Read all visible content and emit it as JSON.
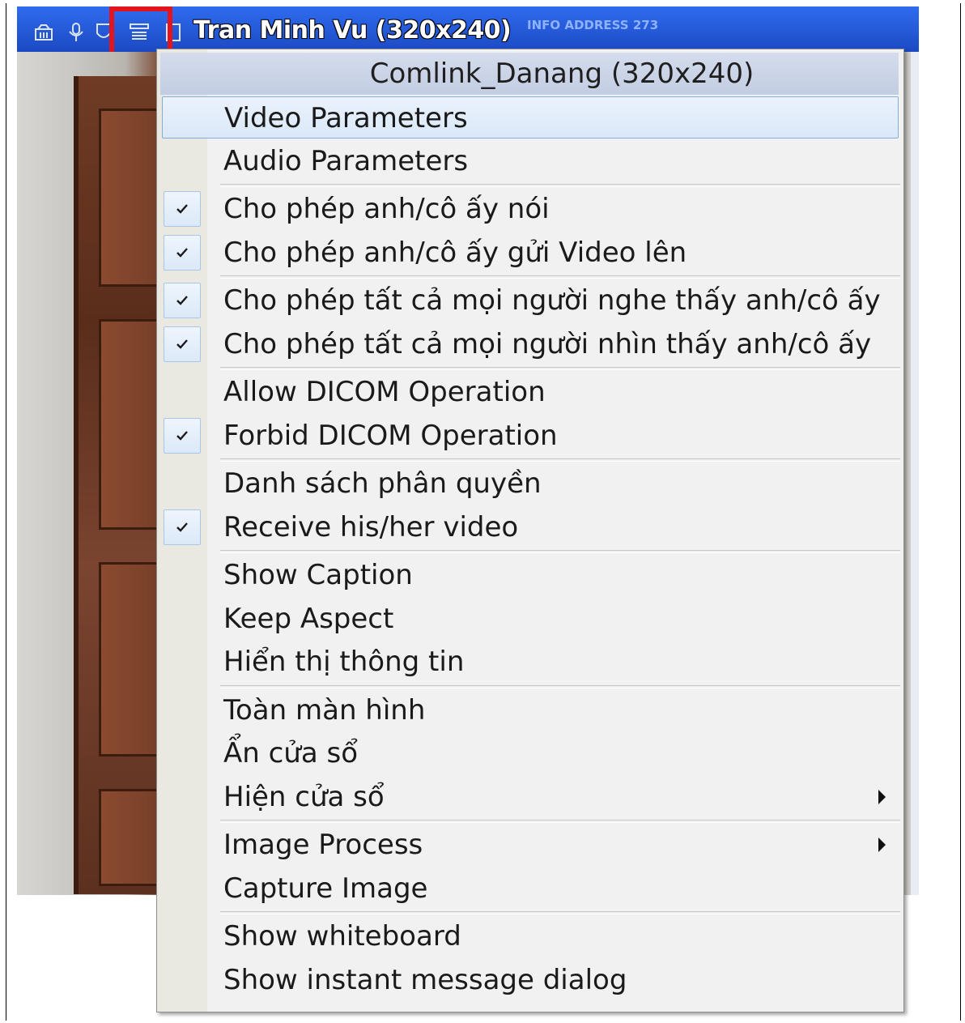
{
  "window": {
    "title": "Tran Minh Vu (320x240)",
    "title_faint": "INFO ADDRESS 273",
    "toolbar_icons": [
      "camera-icon",
      "microphone-icon",
      "shield-icon",
      "menu-list-icon",
      "window-icon"
    ],
    "highlight_color": "#e3141b"
  },
  "menu": {
    "header": "Comlink_Danang (320x240)",
    "groups": [
      [
        {
          "label": "Video Parameters",
          "checked": false,
          "selected": true
        },
        {
          "label": "Audio Parameters",
          "checked": false
        }
      ],
      [
        {
          "label": "Cho phép anh/cô ấy nói",
          "checked": true
        },
        {
          "label": "Cho phép anh/cô ấy gửi Video lên",
          "checked": true
        }
      ],
      [
        {
          "label": "Cho phép tất cả mọi người nghe thấy anh/cô ấy",
          "checked": true
        },
        {
          "label": "Cho phép tất cả mọi người nhìn thấy anh/cô ấy",
          "checked": true
        }
      ],
      [
        {
          "label": "Allow DICOM Operation",
          "checked": false
        },
        {
          "label": "Forbid DICOM Operation",
          "checked": true
        }
      ],
      [
        {
          "label": "Danh sách phân quyền",
          "checked": false
        },
        {
          "label": "Receive his/her video",
          "checked": true
        }
      ],
      [
        {
          "label": "Show Caption",
          "checked": false
        },
        {
          "label": "Keep Aspect",
          "checked": false
        },
        {
          "label": "Hiển thị thông tin",
          "checked": false
        }
      ],
      [
        {
          "label": "Toàn màn hình",
          "checked": false
        },
        {
          "label": "Ẩn cửa sổ",
          "checked": false
        },
        {
          "label": "Hiện cửa sổ",
          "checked": false,
          "submenu": true
        }
      ],
      [
        {
          "label": "Image Process",
          "checked": false,
          "submenu": true
        },
        {
          "label": "Capture Image",
          "checked": false
        }
      ],
      [
        {
          "label": "Show whiteboard",
          "checked": false
        },
        {
          "label": "Show instant message dialog",
          "checked": false
        }
      ]
    ]
  }
}
